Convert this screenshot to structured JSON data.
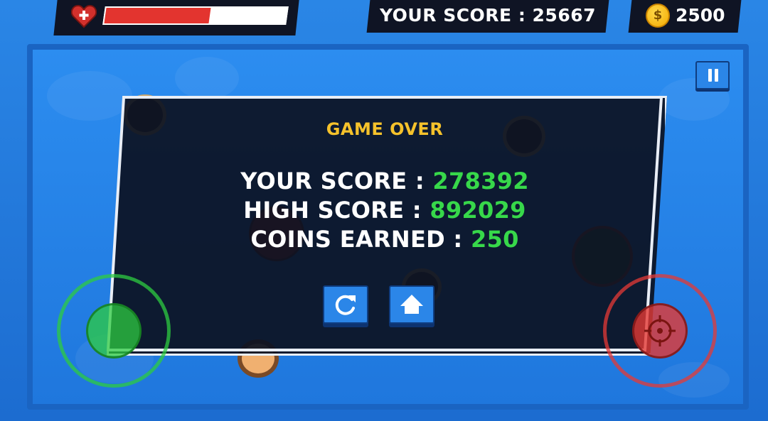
{
  "hud": {
    "health_fraction": 0.58,
    "score_label": "YOUR SCORE : 25667",
    "coin_symbol": "$",
    "coins": "2500"
  },
  "dialog": {
    "title": "GAME OVER",
    "score_label": "YOUR SCORE : ",
    "score_value": "278392",
    "high_score_label": "HIGH SCORE : ",
    "high_score_value": "892029",
    "coins_label": "COINS EARNED : ",
    "coins_value": "250"
  },
  "icons": {
    "health": "heart-icon",
    "coin": "coin-icon",
    "pause": "pause-icon",
    "restart": "restart-icon",
    "home": "home-icon",
    "move_stick": "move-joystick",
    "fire_stick": "crosshair-icon"
  },
  "colors": {
    "health": "#e3342f",
    "title": "#f5c22b",
    "value": "#37d84a",
    "button": "#2b86e8",
    "move_stick": "#2ecc40",
    "fire_stick": "#e53935"
  }
}
